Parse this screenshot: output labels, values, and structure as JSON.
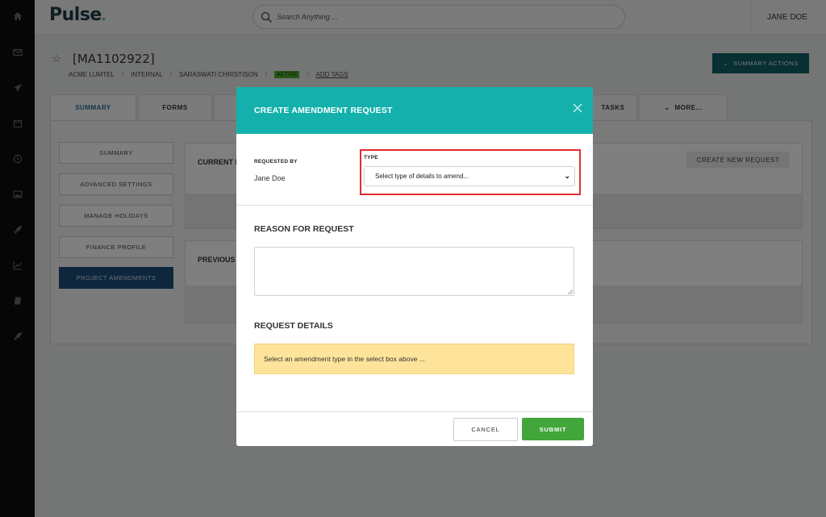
{
  "app": {
    "logo_text": "Pulse",
    "logo_dot": "."
  },
  "search": {
    "placeholder": "Search Anything ..."
  },
  "user": {
    "name": "JANE DOE"
  },
  "project": {
    "id": "[MA1102922]",
    "breadcrumb": [
      "ACME LUMTEL",
      "INTERNAL",
      "SARASWATI CHRISTISON"
    ],
    "status": "ACTIVE",
    "add_tags": "ADD TAGS"
  },
  "header": {
    "summary_actions": "SUMMARY ACTIONS"
  },
  "tabs": [
    {
      "label": "SUMMARY"
    },
    {
      "label": "FORMS"
    },
    {
      "label": "TASKS"
    },
    {
      "label": "MORE..."
    }
  ],
  "side_nav": [
    {
      "label": "SUMMARY"
    },
    {
      "label": "ADVANCED SETTINGS"
    },
    {
      "label": "MANAGE HOLIDAYS"
    },
    {
      "label": "FINANCE PROFILE"
    },
    {
      "label": "PROJECT AMENDMENTS"
    }
  ],
  "cards": {
    "current_title": "CURRENT I",
    "create_new": "CREATE NEW REQUEST",
    "previous_title": "PREVIOUS"
  },
  "modal": {
    "title": "CREATE AMENDMENT REQUEST",
    "requested_by_label": "REQUESTED BY",
    "requested_by_value": "Jane Doe",
    "type_label": "TYPE",
    "type_selected": "Select type of details to amend...",
    "reason_title": "REASON FOR REQUEST",
    "reason_value": "",
    "details_title": "REQUEST DETAILS",
    "details_notice": "Select an amendment type in the select box above ...",
    "cancel": "CANCEL",
    "submit": "SUBMIT"
  },
  "colors": {
    "teal_header": "#14b1ac",
    "sidebar": "#0c0c0c",
    "primary_dark": "#105e63",
    "submit_green": "#42a63a",
    "highlight_red": "#e32d2d",
    "notice_yellow": "#fde49a"
  }
}
